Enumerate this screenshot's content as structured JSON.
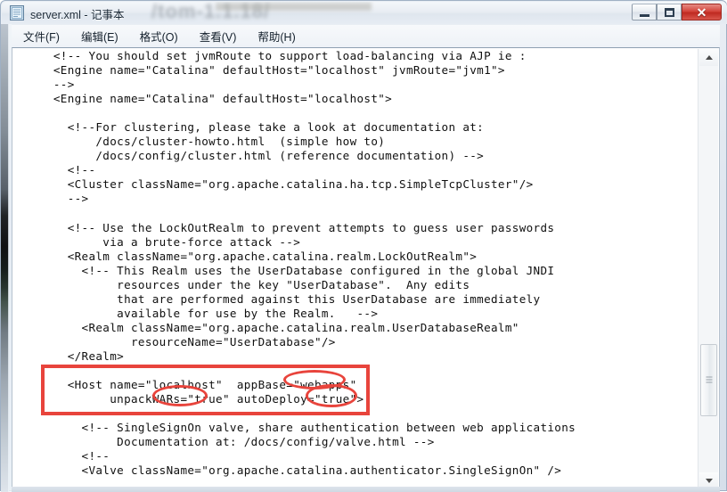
{
  "window": {
    "title": "server.xml - 记事本",
    "ghost_text": "/tom-1.1.18/",
    "icon": "notepad-icon",
    "controls": [
      {
        "name": "minimize-button",
        "label": "—"
      },
      {
        "name": "maximize-button",
        "label": "□"
      },
      {
        "name": "close-button",
        "label": "✕"
      }
    ]
  },
  "menubar": {
    "items": [
      {
        "label": "文件(F)"
      },
      {
        "label": "编辑(E)"
      },
      {
        "label": "格式(O)"
      },
      {
        "label": "查看(V)"
      },
      {
        "label": "帮助(H)"
      }
    ]
  },
  "editor": {
    "lines": [
      "  <!-- You should set jvmRoute to support load-balancing via AJP ie :",
      "  <Engine name=\"Catalina\" defaultHost=\"localhost\" jvmRoute=\"jvm1\">",
      "  -->",
      "  <Engine name=\"Catalina\" defaultHost=\"localhost\">",
      "",
      "    <!--For clustering, please take a look at documentation at:",
      "        /docs/cluster-howto.html  (simple how to)",
      "        /docs/config/cluster.html (reference documentation) -->",
      "    <!--",
      "    <Cluster className=\"org.apache.catalina.ha.tcp.SimpleTcpCluster\"/>",
      "    -->",
      "",
      "    <!-- Use the LockOutRealm to prevent attempts to guess user passwords",
      "         via a brute-force attack -->",
      "    <Realm className=\"org.apache.catalina.realm.LockOutRealm\">",
      "      <!-- This Realm uses the UserDatabase configured in the global JNDI",
      "           resources under the key \"UserDatabase\".  Any edits",
      "           that are performed against this UserDatabase are immediately",
      "           available for use by the Realm.   -->",
      "      <Realm className=\"org.apache.catalina.realm.UserDatabaseRealm\"",
      "             resourceName=\"UserDatabase\"/>",
      "    </Realm>",
      "",
      "    <Host name=\"localhost\"  appBase=\"webapps\"",
      "          unpackWARs=\"true\" autoDeploy=\"true\">",
      "",
      "      <!-- SingleSignOn valve, share authentication between web applications",
      "           Documentation at: /docs/config/valve.html -->",
      "      <!--",
      "      <Valve className=\"org.apache.catalina.authenticator.SingleSignOn\" />"
    ]
  },
  "annotations": {
    "color": "#e8443c",
    "highlight_box_label": "host-element-highlight",
    "circles": [
      {
        "name": "webapps-value-circle",
        "target": "webapps"
      },
      {
        "name": "unpackwars-value-circle",
        "target": "true"
      },
      {
        "name": "autodeploy-value-circle",
        "target": "true"
      }
    ]
  },
  "scrollbar": {
    "up_arrow": "▲",
    "down_arrow": "▼",
    "thumb": "scroll-thumb"
  }
}
